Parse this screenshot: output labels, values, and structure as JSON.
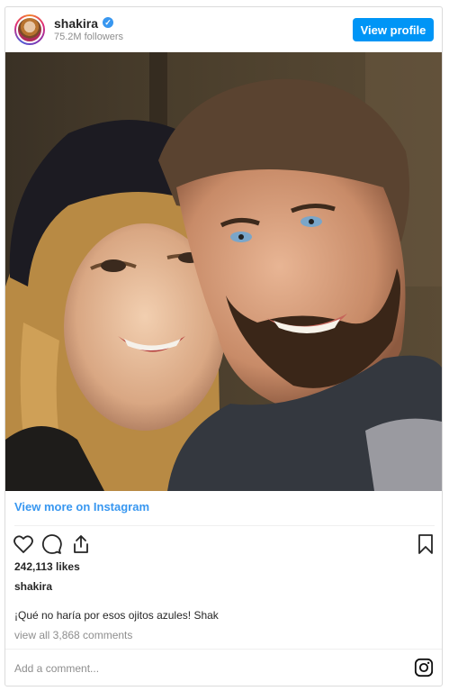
{
  "header": {
    "username": "shakira",
    "verified_icon": "verified-badge-icon",
    "followers": "75.2M followers",
    "view_profile_label": "View profile",
    "button_color": "#0095f6"
  },
  "post": {
    "photo_alt": "photo",
    "view_more_label": "View more on Instagram",
    "link_color": "#3897f0",
    "likes": "242,113 likes",
    "owner": "shakira",
    "caption": "¡Qué no haría por esos ojitos azules! Shak",
    "comments_link": "view all 3,868 comments",
    "comment_placeholder": "Add a comment...",
    "icons": [
      "heart-icon",
      "comment-icon",
      "share-icon",
      "bookmark-icon",
      "instagram-icon"
    ]
  }
}
